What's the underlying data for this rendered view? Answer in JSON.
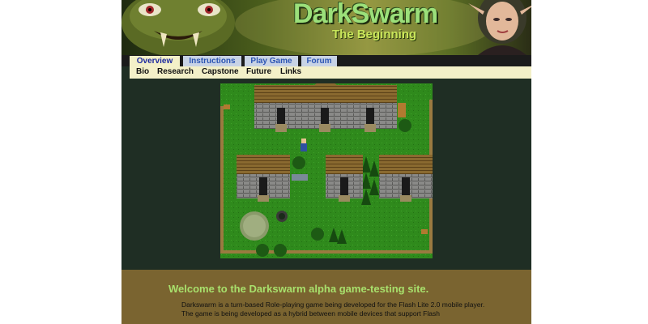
{
  "banner": {
    "title": "DarkSwarm",
    "subtitle": "The Beginning"
  },
  "tabs": [
    {
      "label": "Overview",
      "active": true
    },
    {
      "label": "Instructions",
      "active": false
    },
    {
      "label": "Play Game",
      "active": false
    },
    {
      "label": "Forum",
      "active": false
    }
  ],
  "subnav": [
    "Bio",
    "Research",
    "Capstone",
    "Future",
    "Links"
  ],
  "content": {
    "heading": "Welcome to the Darkswarm alpha game-testing site.",
    "intro": "Darkswarm is a turn-based Role-playing game being developed for the Flash Lite 2.0 mobile player. The game is being developed as a hybrid between mobile devices that support Flash"
  },
  "colors": {
    "tab_bg": "#c8d3e5",
    "tab_active_bg": "#f3f0c8",
    "tab_text": "#2c55b4",
    "page_bg": "#1f2e24",
    "content_bg": "#7a6430",
    "heading": "#a8e06c"
  }
}
